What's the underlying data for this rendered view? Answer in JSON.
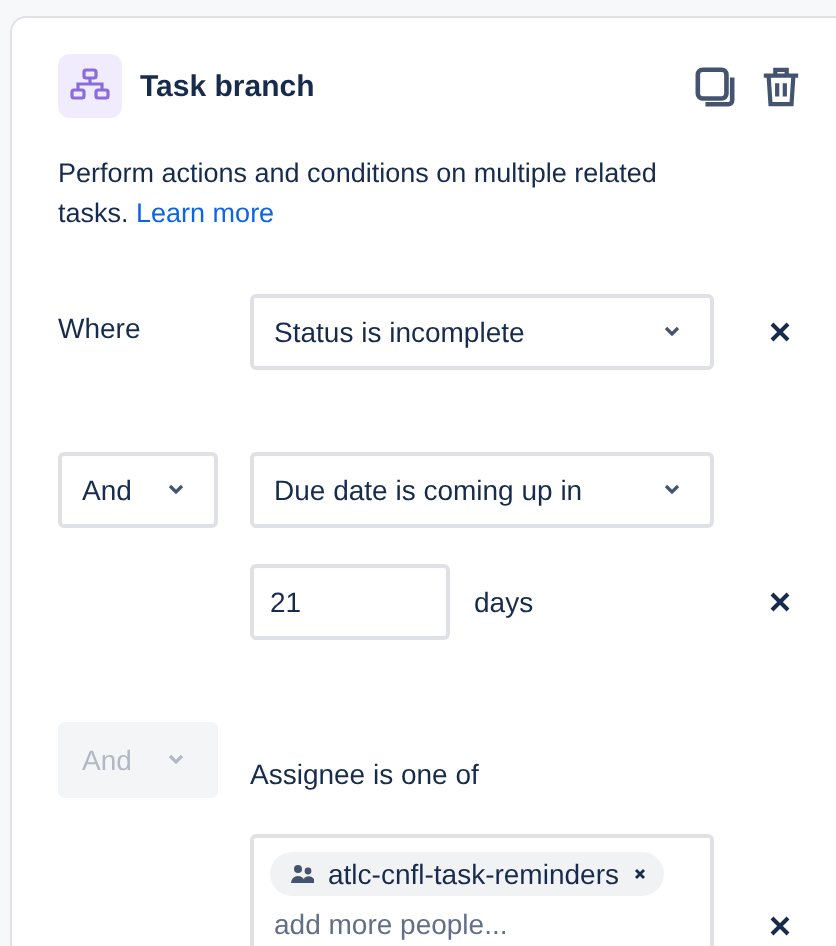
{
  "header": {
    "title": "Task branch"
  },
  "description": {
    "text": "Perform actions and conditions on multiple related tasks.",
    "link": "Learn more"
  },
  "conditions": [
    {
      "connector": {
        "kind": "label",
        "text": "Where"
      },
      "rows": [
        {
          "kind": "select",
          "value": "Status is incomplete",
          "removable": true
        }
      ]
    },
    {
      "connector": {
        "kind": "select",
        "text": "And",
        "disabled": false
      },
      "rows": [
        {
          "kind": "select",
          "value": "Due date is coming up in",
          "removable": false
        },
        {
          "kind": "number",
          "value": "21",
          "unit": "days",
          "removable": true
        }
      ]
    },
    {
      "connector": {
        "kind": "select",
        "text": "And",
        "disabled": true
      },
      "rows": [
        {
          "kind": "text",
          "value": "Assignee is one of",
          "removable": false
        },
        {
          "kind": "people",
          "chips": [
            {
              "label": "atlc-cnfl-task-reminders"
            }
          ],
          "placeholder": "add more people...",
          "removable": true
        }
      ]
    }
  ]
}
